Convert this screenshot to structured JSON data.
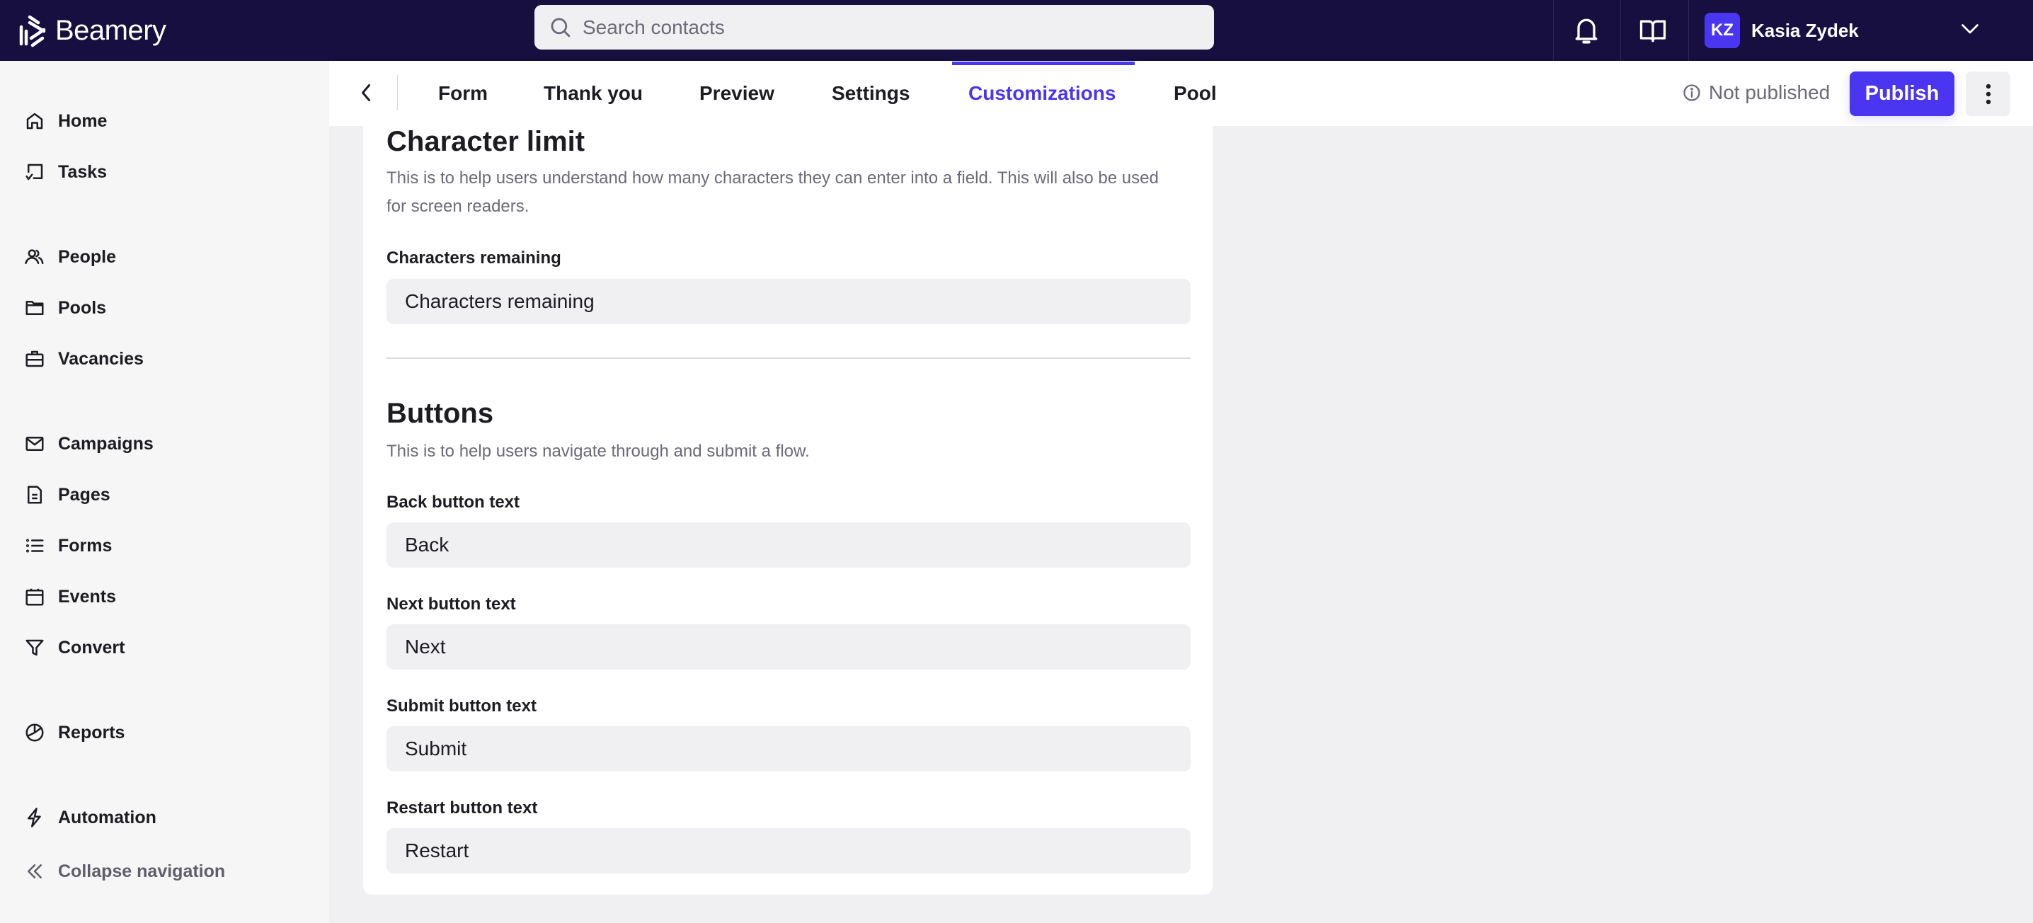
{
  "app": {
    "brand": "Beamery"
  },
  "header": {
    "search": {
      "placeholder": "Search contacts",
      "value": ""
    },
    "icons": [
      "bell-icon",
      "book-open-icon"
    ],
    "user": {
      "initials": "KZ",
      "name": "Kasia Zydek"
    },
    "colors": {
      "header_bg": "#170f40",
      "accent": "#4a35f0"
    }
  },
  "sidebar": {
    "items": [
      {
        "label": "Home",
        "icon": "home-icon"
      },
      {
        "label": "Tasks",
        "icon": "tasks-icon"
      },
      {
        "label": "People",
        "icon": "people-icon"
      },
      {
        "label": "Pools",
        "icon": "folder-icon"
      },
      {
        "label": "Vacancies",
        "icon": "briefcase-icon"
      },
      {
        "label": "Campaigns",
        "icon": "mail-icon"
      },
      {
        "label": "Pages",
        "icon": "document-icon"
      },
      {
        "label": "Forms",
        "icon": "list-icon"
      },
      {
        "label": "Events",
        "icon": "calendar-icon"
      },
      {
        "label": "Convert",
        "icon": "funnel-icon"
      },
      {
        "label": "Reports",
        "icon": "pie-chart-icon"
      },
      {
        "label": "Automation",
        "icon": "lightning-icon"
      }
    ],
    "collapse_label": "Collapse navigation"
  },
  "subnav": {
    "tabs": [
      {
        "label": "Form",
        "active": false
      },
      {
        "label": "Thank you",
        "active": false
      },
      {
        "label": "Preview",
        "active": false
      },
      {
        "label": "Settings",
        "active": false
      },
      {
        "label": "Customizations",
        "active": true
      },
      {
        "label": "Pool",
        "active": false
      }
    ],
    "status": "Not published",
    "publish_label": "Publish"
  },
  "content": {
    "character_limit": {
      "title": "Character limit",
      "description": "This is to help users understand how many characters they can enter into a field. This will also be used for screen readers.",
      "fields": [
        {
          "label": "Characters remaining",
          "value": "Characters remaining"
        }
      ]
    },
    "buttons": {
      "title": "Buttons",
      "description": "This is to help users navigate through and submit a flow.",
      "fields": [
        {
          "label": "Back button text",
          "value": "Back"
        },
        {
          "label": "Next button text",
          "value": "Next"
        },
        {
          "label": "Submit button text",
          "value": "Submit"
        },
        {
          "label": "Restart button text",
          "value": "Restart"
        }
      ]
    }
  }
}
